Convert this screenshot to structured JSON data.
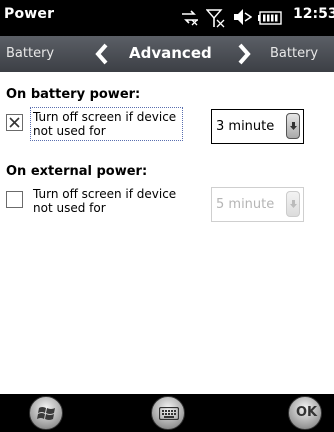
{
  "status_bar": {
    "app_title": "Power",
    "time": "12:53",
    "icons": [
      "connectivity-icon",
      "signal-off-icon",
      "volume-icon",
      "battery-icon"
    ]
  },
  "tabs": {
    "previous": "Battery",
    "current": "Advanced",
    "next": "Battery"
  },
  "battery_power": {
    "heading": "On battery power:",
    "checkbox_checked": true,
    "checkbox_label": "Turn off screen if device not used for",
    "timeout_value": "3 minute"
  },
  "external_power": {
    "heading": "On external power:",
    "checkbox_checked": false,
    "checkbox_label": "Turn off screen if device not used for",
    "timeout_value": "5 minute"
  },
  "bottom_bar": {
    "ok_label": "OK",
    "icons": [
      "windows-start-icon",
      "keyboard-icon",
      "ok-icon"
    ]
  }
}
